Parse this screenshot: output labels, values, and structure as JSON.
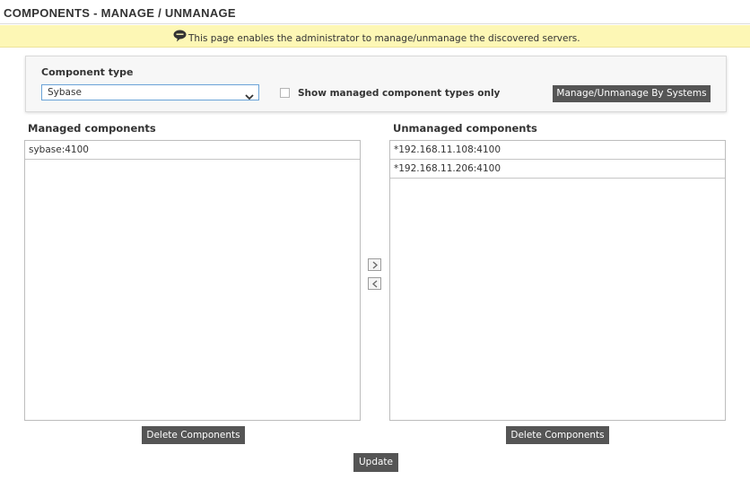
{
  "header": {
    "title": "COMPONENTS - MANAGE / UNMANAGE"
  },
  "info": {
    "message": "This page enables the administrator to manage/unmanage the discovered servers.",
    "icon": "speech-bubble-icon"
  },
  "filter": {
    "component_type_label": "Component type",
    "component_type_value": "Sybase",
    "show_managed_label": "Show managed component types only",
    "show_managed_checked": false,
    "manage_by_systems_label": "Manage/Unmanage By Systems"
  },
  "managed": {
    "title": "Managed components",
    "items": [
      "sybase:4100"
    ],
    "delete_label": "Delete Components"
  },
  "unmanaged": {
    "title": "Unmanaged components",
    "items": [
      "*192.168.11.108:4100",
      "*192.168.11.206:4100"
    ],
    "delete_label": "Delete Components"
  },
  "transfer": {
    "move_right_icon": "chevron-right-icon",
    "move_left_icon": "chevron-left-icon"
  },
  "footer": {
    "update_label": "Update"
  },
  "colors": {
    "info_bg": "#fdf7b5",
    "button_bg": "#555555",
    "select_border": "#6aa3d8"
  }
}
